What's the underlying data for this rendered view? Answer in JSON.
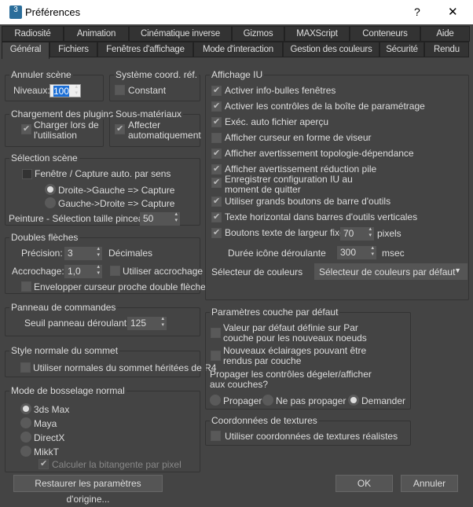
{
  "window": {
    "title": "Préférences",
    "help": "?",
    "close": "✕",
    "app_icon": "3"
  },
  "tabs_row1": [
    "Radiosité",
    "Animation",
    "Cinématique inverse",
    "Gizmos",
    "MAXScript",
    "Conteneurs",
    "Aide"
  ],
  "tabs_row2": [
    "Général",
    "Fichiers",
    "Fenêtres d'affichage",
    "Mode d'interaction",
    "Gestion des couleurs",
    "Sécurité",
    "Rendu"
  ],
  "undo": {
    "title": "Annuler scène",
    "levels_label": "Niveaux:",
    "levels": "100"
  },
  "coord": {
    "title": "Système coord. réf.",
    "constant": "Constant",
    "constant_checked": false
  },
  "plugins": {
    "title": "Chargement des plugins",
    "load_label1": "Charger lors de",
    "load_label2": "l'utilisation",
    "checked": true
  },
  "submat": {
    "title": "Sous-matériaux",
    "label1": "Affecter",
    "label2": "automatiquement",
    "checked": true
  },
  "selection": {
    "title": "Sélection scène",
    "auto": "Fenêtre / Capture auto. par sens",
    "auto_checked": false,
    "r2l": "Droite->Gauche => Capture",
    "l2r": "Gauche->Droite => Capture",
    "brush_label": "Peinture - Sélection taille pinceau",
    "brush": "50"
  },
  "spinners": {
    "title": "Doubles flèches",
    "precision_label": "Précision:",
    "precision": "3",
    "decimals": "Décimales",
    "snap_label": "Accrochage:",
    "snap": "1,0",
    "use_snap": "Utiliser accrochage",
    "wrap": "Envelopper curseur proche double flèche"
  },
  "cmdpanel": {
    "title": "Panneau de commandes",
    "rollup_label": "Seuil panneau déroulant:",
    "rollup": "125"
  },
  "vnormal": {
    "title": "Style normale du sommet",
    "legacy": "Utiliser normales du sommet héritées de R4"
  },
  "bump": {
    "title": "Mode de bosselage normal",
    "options": [
      "3ds Max",
      "Maya",
      "DirectX",
      "MikkT"
    ],
    "selected": 0,
    "bitangent": "Calculer la bitangente par pixel"
  },
  "ui": {
    "title": "Affichage IU",
    "items": [
      {
        "label": "Activer info-bulles fenêtres",
        "checked": true
      },
      {
        "label": "Activer les contrôles de la boîte de paramétrage",
        "checked": true
      },
      {
        "label": "Exéc. auto fichier aperçu",
        "checked": true
      },
      {
        "label": "Afficher curseur en forme de viseur",
        "checked": false
      },
      {
        "label": "Afficher avertissement topologie-dépendance",
        "checked": true
      },
      {
        "label": "Afficher avertissement réduction pile",
        "checked": true
      },
      {
        "label": "Enregistrer configuration IU au",
        "label2": "moment de quitter",
        "checked": true
      },
      {
        "label": "Utiliser grands boutons de barre d'outils",
        "checked": true
      },
      {
        "label": "Texte horizontal dans barres d'outils verticales",
        "checked": true
      },
      {
        "label": "Boutons texte de largeur fixe",
        "checked": true
      }
    ],
    "fixed_width": "70",
    "pixels": "pixels",
    "flyout_label": "Durée icône déroulante",
    "flyout": "300",
    "msec": "msec",
    "picker_label": "Sélecteur de couleurs",
    "picker": "Sélecteur de couleurs par défaut"
  },
  "layer": {
    "title": "Paramètres couche par défaut",
    "bylayer1": "Valeur par défaut définie sur Par",
    "bylayer2": "couche pour les nouveaux noeuds",
    "lights1": "Nouveaux éclairages pouvant être",
    "lights2": "rendus par couche",
    "propagate1": "Propager les contrôles dégeler/afficher",
    "propagate2": "aux couches?",
    "options": [
      "Propager",
      "Ne pas propager",
      "Demander"
    ],
    "selected": 2
  },
  "texcoord": {
    "title": "Coordonnées de textures",
    "realworld": "Utiliser coordonnées de textures réalistes"
  },
  "buttons": {
    "reset": "Restaurer les paramètres d'origine...",
    "ok": "OK",
    "cancel": "Annuler"
  }
}
